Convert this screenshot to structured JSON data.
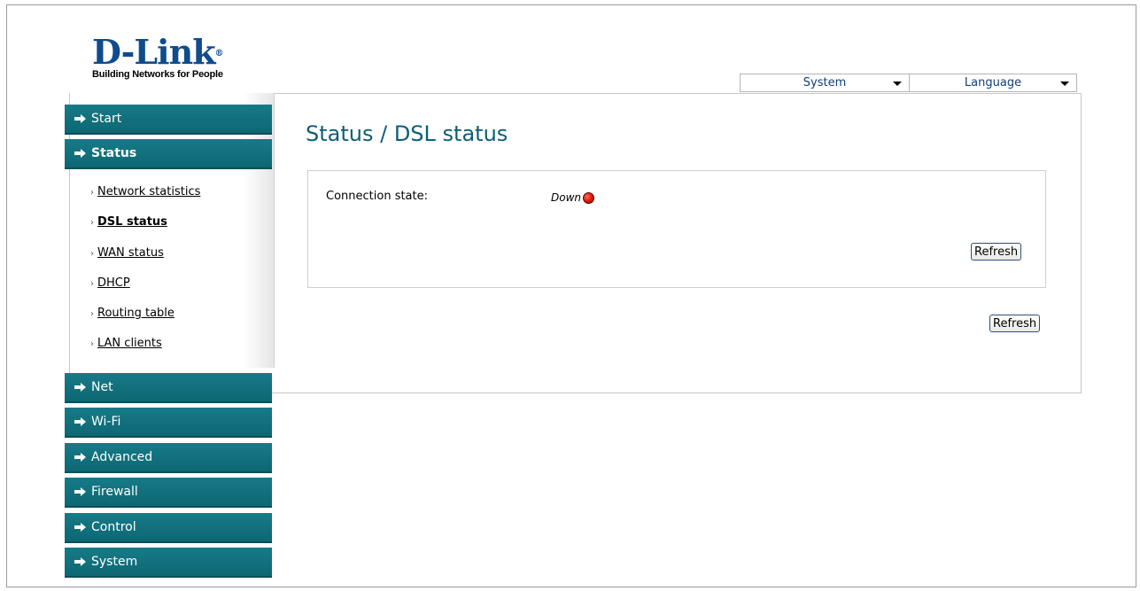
{
  "logo": {
    "brand": "D-Link",
    "reg": "®",
    "tagline": "Building Networks for People"
  },
  "top_selects": {
    "system": "System",
    "language": "Language"
  },
  "sidebar": {
    "headers": [
      {
        "label": "Start"
      },
      {
        "label": "Status"
      },
      {
        "label": "Net"
      },
      {
        "label": "Wi-Fi"
      },
      {
        "label": "Advanced"
      },
      {
        "label": "Firewall"
      },
      {
        "label": "Control"
      },
      {
        "label": "System"
      }
    ],
    "status_items": [
      {
        "label": "Network statistics"
      },
      {
        "label": "DSL status"
      },
      {
        "label": "WAN status"
      },
      {
        "label": "DHCP"
      },
      {
        "label": "Routing table"
      },
      {
        "label": "LAN clients"
      }
    ],
    "bullet": "›"
  },
  "content": {
    "title": "Status / DSL status",
    "connection_label": "Connection state:",
    "connection_value": "Down",
    "refresh_inner": "Refresh",
    "refresh_outer": "Refresh"
  },
  "colors": {
    "menu_bg": "#137280",
    "title": "#0f5d78",
    "status_down": "#e01b0a"
  }
}
